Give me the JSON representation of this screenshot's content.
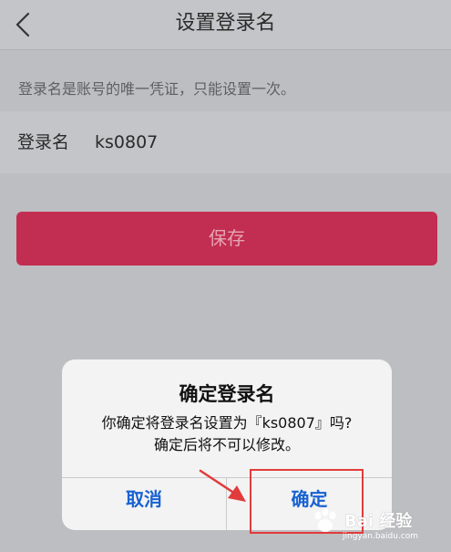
{
  "navbar": {
    "title": "设置登录名",
    "back_icon": "chevron-left-icon"
  },
  "hint": "登录名是账号的唯一凭证，只能设置一次。",
  "field": {
    "label": "登录名",
    "value": "ks0807"
  },
  "save_label": "保存",
  "dialog": {
    "title": "确定登录名",
    "message_line1": "你确定将登录名设置为『ks0807』吗?",
    "message_line2": "确定后将不可以修改。",
    "cancel_label": "取消",
    "confirm_label": "确定"
  },
  "watermark": {
    "text": "Bai 经验",
    "sub": "jingyan.baidu.com"
  },
  "colors": {
    "accent": "#c22e51",
    "dialog_button": "#1862d2",
    "annotation": "#e23b3b"
  }
}
